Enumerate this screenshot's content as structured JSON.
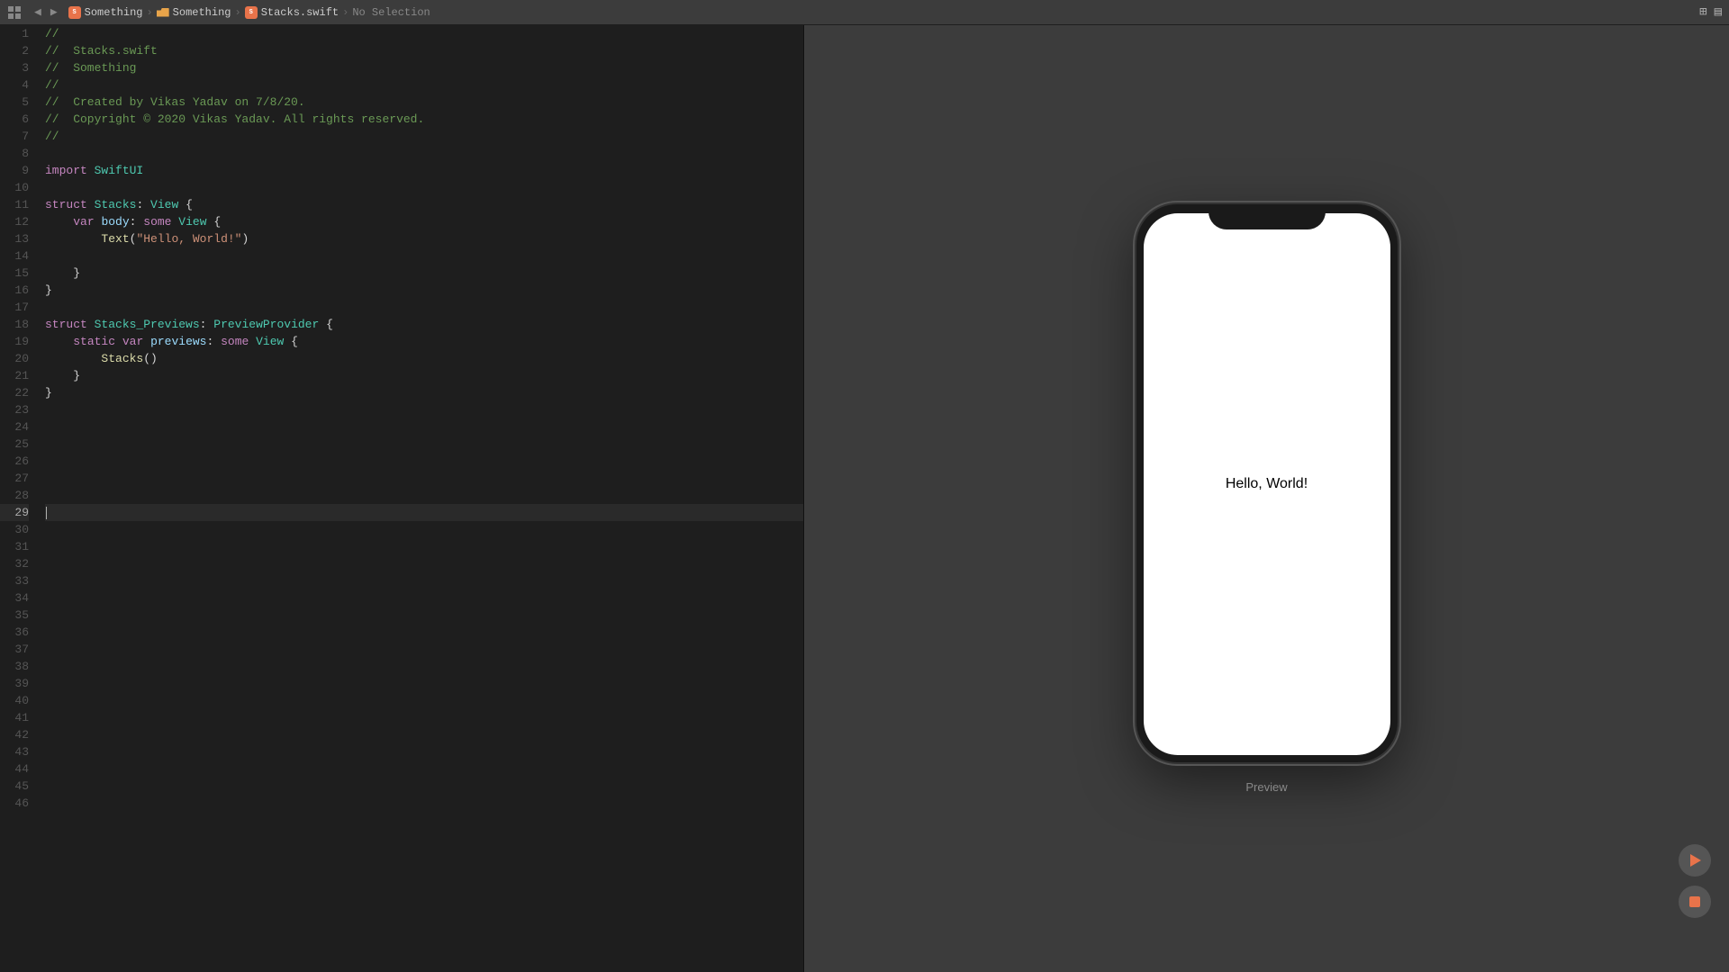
{
  "topbar": {
    "breadcrumb": [
      {
        "type": "grid-icon",
        "label": "app-grid"
      },
      {
        "type": "separator"
      },
      {
        "type": "nav-back",
        "label": "◀"
      },
      {
        "type": "nav-forward",
        "label": "▶"
      },
      {
        "type": "separator"
      },
      {
        "type": "swift-icon",
        "label": "Something",
        "icon": "swift"
      },
      {
        "text": "Something",
        "icon": "file"
      },
      {
        "type": "separator"
      },
      {
        "type": "folder-icon",
        "label": "Something",
        "icon": "folder"
      },
      {
        "text": "Something",
        "icon": "folder"
      },
      {
        "type": "separator"
      },
      {
        "type": "swift-icon",
        "label": "Stacks.swift",
        "icon": "swift"
      },
      {
        "text": "Stacks.swift"
      },
      {
        "type": "separator"
      },
      {
        "text": "No Selection",
        "dim": true
      }
    ],
    "right_icons": [
      "adjust-icon",
      "sidebar-icon"
    ]
  },
  "editor": {
    "filename": "Stacks.swift",
    "lines": [
      {
        "num": 1,
        "tokens": [
          {
            "t": "comment",
            "v": "//"
          }
        ]
      },
      {
        "num": 2,
        "tokens": [
          {
            "t": "comment",
            "v": "//  Stacks.swift"
          }
        ]
      },
      {
        "num": 3,
        "tokens": [
          {
            "t": "comment",
            "v": "//  Something"
          }
        ]
      },
      {
        "num": 4,
        "tokens": [
          {
            "t": "comment",
            "v": "//"
          }
        ]
      },
      {
        "num": 5,
        "tokens": [
          {
            "t": "comment",
            "v": "//  Created by Vikas Yadav on 7/8/20."
          }
        ]
      },
      {
        "num": 6,
        "tokens": [
          {
            "t": "comment",
            "v": "//  Copyright © 2020 Vikas Yadav. All rights reserved."
          }
        ]
      },
      {
        "num": 7,
        "tokens": [
          {
            "t": "comment",
            "v": "//"
          }
        ]
      },
      {
        "num": 8,
        "tokens": []
      },
      {
        "num": 9,
        "tokens": [
          {
            "t": "keyword",
            "v": "import"
          },
          {
            "t": "plain",
            "v": " "
          },
          {
            "t": "module",
            "v": "SwiftUI"
          }
        ]
      },
      {
        "num": 10,
        "tokens": []
      },
      {
        "num": 11,
        "tokens": [
          {
            "t": "keyword",
            "v": "struct"
          },
          {
            "t": "plain",
            "v": " "
          },
          {
            "t": "type",
            "v": "Stacks"
          },
          {
            "t": "plain",
            "v": ": "
          },
          {
            "t": "type",
            "v": "View"
          },
          {
            "t": "plain",
            "v": " {"
          }
        ]
      },
      {
        "num": 12,
        "tokens": [
          {
            "t": "plain",
            "v": "    "
          },
          {
            "t": "keyword",
            "v": "var"
          },
          {
            "t": "plain",
            "v": " "
          },
          {
            "t": "var",
            "v": "body"
          },
          {
            "t": "plain",
            "v": ": "
          },
          {
            "t": "keyword",
            "v": "some"
          },
          {
            "t": "plain",
            "v": " "
          },
          {
            "t": "type",
            "v": "View"
          },
          {
            "t": "plain",
            "v": " {"
          }
        ]
      },
      {
        "num": 13,
        "tokens": [
          {
            "t": "plain",
            "v": "        "
          },
          {
            "t": "func",
            "v": "Text"
          },
          {
            "t": "plain",
            "v": "("
          },
          {
            "t": "string",
            "v": "\"Hello, World!\""
          },
          {
            "t": "plain",
            "v": ")"
          }
        ]
      },
      {
        "num": 14,
        "tokens": []
      },
      {
        "num": 15,
        "tokens": [
          {
            "t": "plain",
            "v": "    }"
          }
        ]
      },
      {
        "num": 16,
        "tokens": [
          {
            "t": "plain",
            "v": "}"
          }
        ]
      },
      {
        "num": 17,
        "tokens": []
      },
      {
        "num": 18,
        "tokens": [
          {
            "t": "keyword",
            "v": "struct"
          },
          {
            "t": "plain",
            "v": " "
          },
          {
            "t": "type",
            "v": "Stacks_Previews"
          },
          {
            "t": "plain",
            "v": ": "
          },
          {
            "t": "type",
            "v": "PreviewProvider"
          },
          {
            "t": "plain",
            "v": " {"
          }
        ]
      },
      {
        "num": 19,
        "tokens": [
          {
            "t": "plain",
            "v": "    "
          },
          {
            "t": "keyword",
            "v": "static"
          },
          {
            "t": "plain",
            "v": " "
          },
          {
            "t": "keyword",
            "v": "var"
          },
          {
            "t": "plain",
            "v": " "
          },
          {
            "t": "var",
            "v": "previews"
          },
          {
            "t": "plain",
            "v": ": "
          },
          {
            "t": "keyword",
            "v": "some"
          },
          {
            "t": "plain",
            "v": " "
          },
          {
            "t": "type",
            "v": "View"
          },
          {
            "t": "plain",
            "v": " {"
          }
        ]
      },
      {
        "num": 20,
        "tokens": [
          {
            "t": "plain",
            "v": "        "
          },
          {
            "t": "func",
            "v": "Stacks"
          },
          {
            "t": "plain",
            "v": "()"
          }
        ]
      },
      {
        "num": 21,
        "tokens": [
          {
            "t": "plain",
            "v": "    }"
          }
        ]
      },
      {
        "num": 22,
        "tokens": [
          {
            "t": "plain",
            "v": "}"
          }
        ]
      },
      {
        "num": 23,
        "tokens": []
      },
      {
        "num": 24,
        "tokens": []
      },
      {
        "num": 25,
        "tokens": []
      },
      {
        "num": 26,
        "tokens": []
      },
      {
        "num": 27,
        "tokens": []
      },
      {
        "num": 28,
        "tokens": []
      },
      {
        "num": 29,
        "tokens": [],
        "active": true,
        "cursor": true
      },
      {
        "num": 30,
        "tokens": []
      },
      {
        "num": 31,
        "tokens": []
      },
      {
        "num": 32,
        "tokens": []
      },
      {
        "num": 33,
        "tokens": []
      },
      {
        "num": 34,
        "tokens": []
      },
      {
        "num": 35,
        "tokens": []
      },
      {
        "num": 36,
        "tokens": []
      },
      {
        "num": 37,
        "tokens": []
      },
      {
        "num": 38,
        "tokens": []
      },
      {
        "num": 39,
        "tokens": []
      },
      {
        "num": 40,
        "tokens": []
      },
      {
        "num": 41,
        "tokens": []
      },
      {
        "num": 42,
        "tokens": []
      },
      {
        "num": 43,
        "tokens": []
      },
      {
        "num": 44,
        "tokens": []
      },
      {
        "num": 45,
        "tokens": []
      },
      {
        "num": 46,
        "tokens": []
      }
    ]
  },
  "preview": {
    "label": "Preview",
    "phone_text": "Hello, World!",
    "play_label": "Run Preview",
    "stop_label": "Stop Preview"
  }
}
